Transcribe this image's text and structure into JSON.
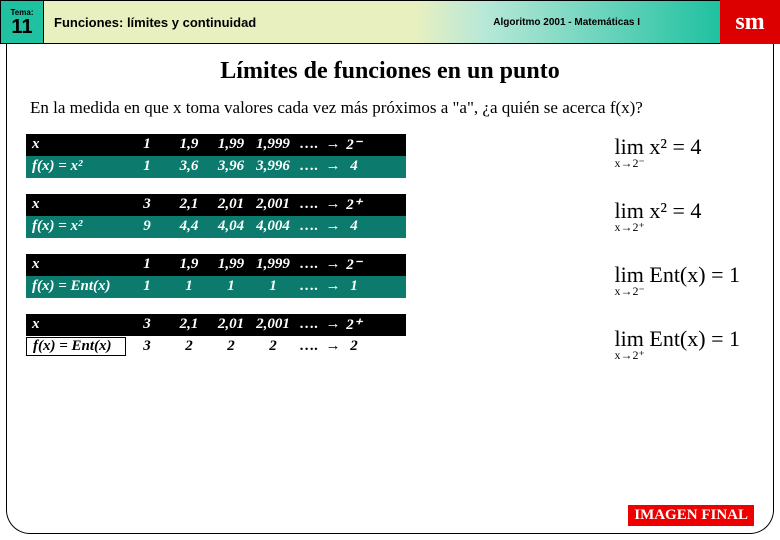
{
  "header": {
    "tema_label": "Tema:",
    "tema_num": "11",
    "chapter": "Funciones: límites y continuidad",
    "algo": "Algoritmo 2001 - Matemáticas I",
    "logo": "sm"
  },
  "title": "Límites de funciones en un punto",
  "question": "En la medida en que x toma valores cada vez más próximos a \"a\", ¿a quién se acerca f(x)?",
  "tables": [
    {
      "row1_label": "x",
      "row1": [
        "1",
        "1,9",
        "1,99",
        "1,999",
        "….",
        "→",
        "2⁻"
      ],
      "row2_label": "f(x) = x²",
      "row2": [
        "1",
        "3,6",
        "3,96",
        "3,996",
        "….",
        "→",
        "4"
      ]
    },
    {
      "row1_label": "x",
      "row1": [
        "3",
        "2,1",
        "2,01",
        "2,001",
        "….",
        "→",
        "2⁺"
      ],
      "row2_label": "f(x) = x²",
      "row2": [
        "9",
        "4,4",
        "4,04",
        "4,004",
        "….",
        "→",
        "4"
      ]
    },
    {
      "row1_label": "x",
      "row1": [
        "1",
        "1,9",
        "1,99",
        "1,999",
        "….",
        "→",
        "2⁻"
      ],
      "row2_label": "f(x) = Ent(x)",
      "row2": [
        "1",
        "1",
        "1",
        "1",
        "….",
        "→",
        "1"
      ]
    },
    {
      "row1_label": "x",
      "row1": [
        "3",
        "2,1",
        "2,01",
        "2,001",
        "….",
        "→",
        "2⁺"
      ],
      "row2_label": "f(x) = Ent(x)",
      "row2": [
        "3",
        "2",
        "2",
        "2",
        "….",
        "→",
        "2"
      ]
    }
  ],
  "formulas": [
    {
      "text": "lim x² = 4",
      "sub": "x→2⁻"
    },
    {
      "text": "lim x² = 4",
      "sub": "x→2⁺"
    },
    {
      "text": "lim Ent(x) = 1",
      "sub": "x→2⁻"
    },
    {
      "text": "lim Ent(x) = 1",
      "sub": "x→2⁺"
    }
  ],
  "footer_button": "IMAGEN FINAL"
}
